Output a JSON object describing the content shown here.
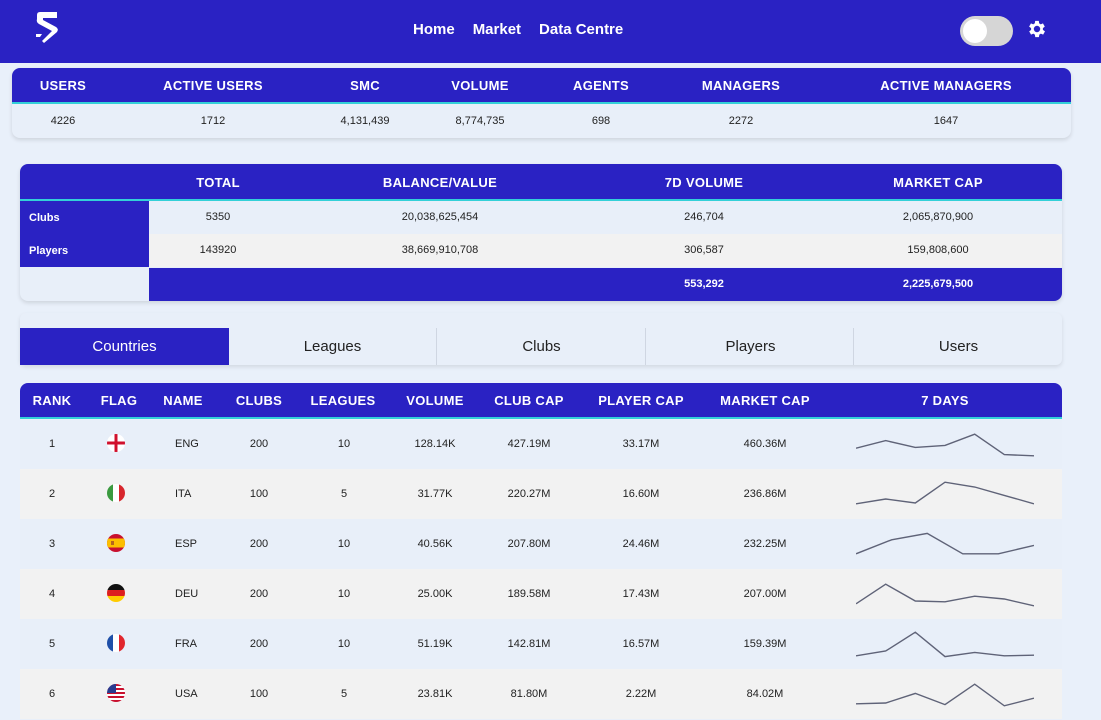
{
  "nav": {
    "logo": "app-logo",
    "links": [
      "Home",
      "Market",
      "Data Centre"
    ],
    "theme_toggle": "off",
    "settings_icon": "gear-icon"
  },
  "stats": {
    "headers": [
      "USERS",
      "ACTIVE USERS",
      "SMC",
      "VOLUME",
      "AGENTS",
      "MANAGERS",
      "ACTIVE MANAGERS"
    ],
    "values": [
      "4226",
      "1712",
      "4,131,439",
      "8,774,735",
      "698",
      "2272",
      "1647"
    ]
  },
  "summary": {
    "headers": [
      "TOTAL",
      "BALANCE/VALUE",
      "7D VOLUME",
      "MARKET CAP"
    ],
    "rows": [
      {
        "label": "Clubs",
        "total": "5350",
        "balance": "20,038,625,454",
        "volume": "246,704",
        "cap": "2,065,870,900"
      },
      {
        "label": "Players",
        "total": "143920",
        "balance": "38,669,910,708",
        "volume": "306,587",
        "cap": "159,808,600"
      }
    ],
    "totals": {
      "volume": "553,292",
      "cap": "2,225,679,500"
    }
  },
  "tabs": {
    "items": [
      "Countries",
      "Leagues",
      "Clubs",
      "Players",
      "Users"
    ],
    "active": "Countries"
  },
  "table": {
    "headers": [
      "RANK",
      "FLAG",
      "NAME",
      "CLUBS",
      "LEAGUES",
      "VOLUME",
      "CLUB CAP",
      "PLAYER CAP",
      "MARKET CAP",
      "7 DAYS"
    ],
    "rows": [
      {
        "rank": "1",
        "flag": "england",
        "name": "ENG",
        "clubs": "200",
        "leagues": "10",
        "volume": "128.14K",
        "club_cap": "427.19M",
        "player_cap": "33.17M",
        "market_cap": "460.36M",
        "trend": [
          0.35,
          0.62,
          0.38,
          0.45,
          0.85,
          0.12,
          0.08
        ]
      },
      {
        "rank": "2",
        "flag": "italy",
        "name": "ITA",
        "clubs": "100",
        "leagues": "5",
        "volume": "31.77K",
        "club_cap": "220.27M",
        "player_cap": "16.60M",
        "market_cap": "236.86M",
        "trend": [
          0.15,
          0.32,
          0.18,
          0.92,
          0.75,
          0.45,
          0.15
        ]
      },
      {
        "rank": "3",
        "flag": "spain",
        "name": "ESP",
        "clubs": "200",
        "leagues": "10",
        "volume": "40.56K",
        "club_cap": "207.80M",
        "player_cap": "24.46M",
        "market_cap": "232.25M",
        "trend": [
          0.15,
          0.65,
          0.88,
          0.15,
          0.15,
          0.45
        ]
      },
      {
        "rank": "4",
        "flag": "germany",
        "name": "DEU",
        "clubs": "200",
        "leagues": "10",
        "volume": "25.00K",
        "club_cap": "189.58M",
        "player_cap": "17.43M",
        "market_cap": "207.00M",
        "trend": [
          0.15,
          0.85,
          0.25,
          0.22,
          0.42,
          0.32,
          0.08
        ]
      },
      {
        "rank": "5",
        "flag": "france",
        "name": "FRA",
        "clubs": "200",
        "leagues": "10",
        "volume": "51.19K",
        "club_cap": "142.81M",
        "player_cap": "16.57M",
        "market_cap": "159.39M",
        "trend": [
          0.08,
          0.25,
          0.92,
          0.05,
          0.2,
          0.08,
          0.1
        ]
      },
      {
        "rank": "6",
        "flag": "usa",
        "name": "USA",
        "clubs": "100",
        "leagues": "5",
        "volume": "23.81K",
        "club_cap": "81.80M",
        "player_cap": "2.22M",
        "market_cap": "84.02M",
        "trend": [
          0.15,
          0.18,
          0.52,
          0.12,
          0.85,
          0.08,
          0.35
        ]
      }
    ]
  },
  "colors": {
    "primary": "#2a22c3",
    "accent": "#33d0d8",
    "row_alt": "#f2f2f2",
    "row": "#e8eff9",
    "spark": "#5f6378"
  }
}
